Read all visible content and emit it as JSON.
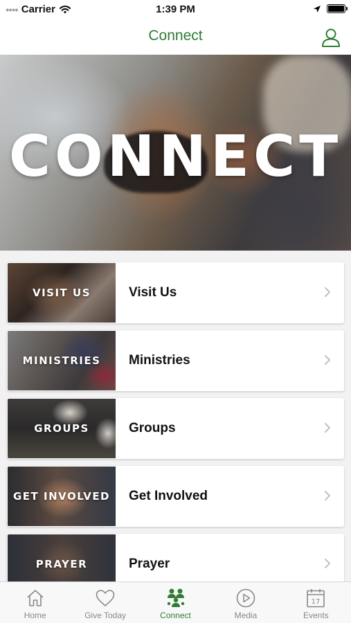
{
  "status_bar": {
    "carrier": "Carrier",
    "time": "1:39 PM"
  },
  "nav": {
    "title": "Connect",
    "profile_icon": "person-icon"
  },
  "hero": {
    "text": "CONNECT"
  },
  "items": [
    {
      "thumb_text": "VISIT US",
      "label": "Visit Us"
    },
    {
      "thumb_text": "MINISTRIES",
      "label": "Ministries"
    },
    {
      "thumb_text": "GROUPS",
      "label": "Groups"
    },
    {
      "thumb_text": "GET INVOLVED",
      "label": "Get Involved"
    },
    {
      "thumb_text": "PRAYER",
      "label": "Prayer"
    }
  ],
  "tabs": [
    {
      "label": "Home",
      "icon": "home-icon",
      "active": false
    },
    {
      "label": "Give Today",
      "icon": "heart-icon",
      "active": false
    },
    {
      "label": "Connect",
      "icon": "people-icon",
      "active": true
    },
    {
      "label": "Media",
      "icon": "play-icon",
      "active": false
    },
    {
      "label": "Events",
      "icon": "calendar-icon",
      "active": false
    }
  ],
  "calendar_day": "17",
  "colors": {
    "accent": "#2e7d32",
    "tab_inactive": "#888888",
    "background": "#f2f2f2"
  }
}
